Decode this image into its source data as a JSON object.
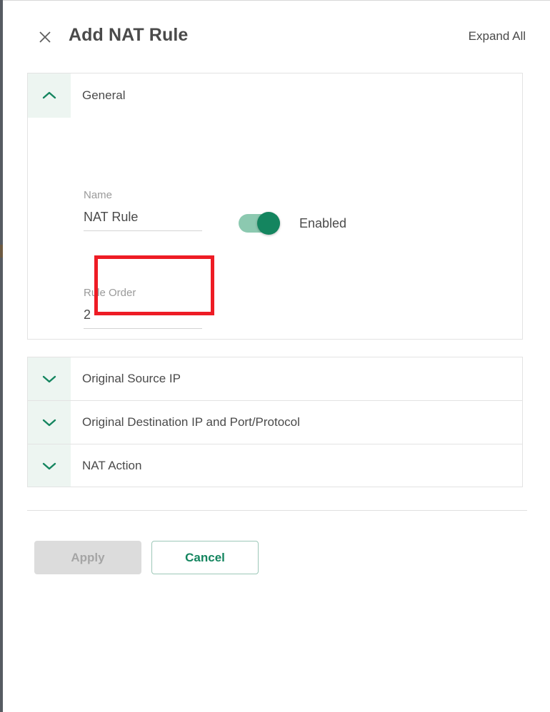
{
  "dialog": {
    "title": "Add NAT Rule",
    "close_icon": "close-icon",
    "expand_all_label": "Expand All"
  },
  "general_section": {
    "label": "General",
    "chevron_icon": "chevron-up-icon",
    "expanded": true,
    "fields": {
      "name": {
        "label": "Name",
        "value": "NAT Rule",
        "highlighted": true
      },
      "rule_order": {
        "label": "Rule Order",
        "value": "2"
      }
    },
    "toggle": {
      "label": "Enabled",
      "state": "on"
    }
  },
  "collapsed_sections": [
    {
      "label": "Original Source IP",
      "chevron_icon": "chevron-down-icon"
    },
    {
      "label": "Original Destination IP and Port/Protocol",
      "chevron_icon": "chevron-down-icon"
    },
    {
      "label": "NAT Action",
      "chevron_icon": "chevron-down-icon"
    }
  ],
  "footer": {
    "apply_label": "Apply",
    "cancel_label": "Cancel",
    "apply_disabled": true
  },
  "colors": {
    "accent_green": "#14855f",
    "toggle_track": "#8cc9b0",
    "chevron_cell_bg": "#edf5f1",
    "highlight_red": "#ee1c25",
    "text_primary": "#4a4a4a",
    "text_muted": "#9a9a9a",
    "border": "#e3e3e3",
    "disabled_bg": "#dcdcdc"
  }
}
